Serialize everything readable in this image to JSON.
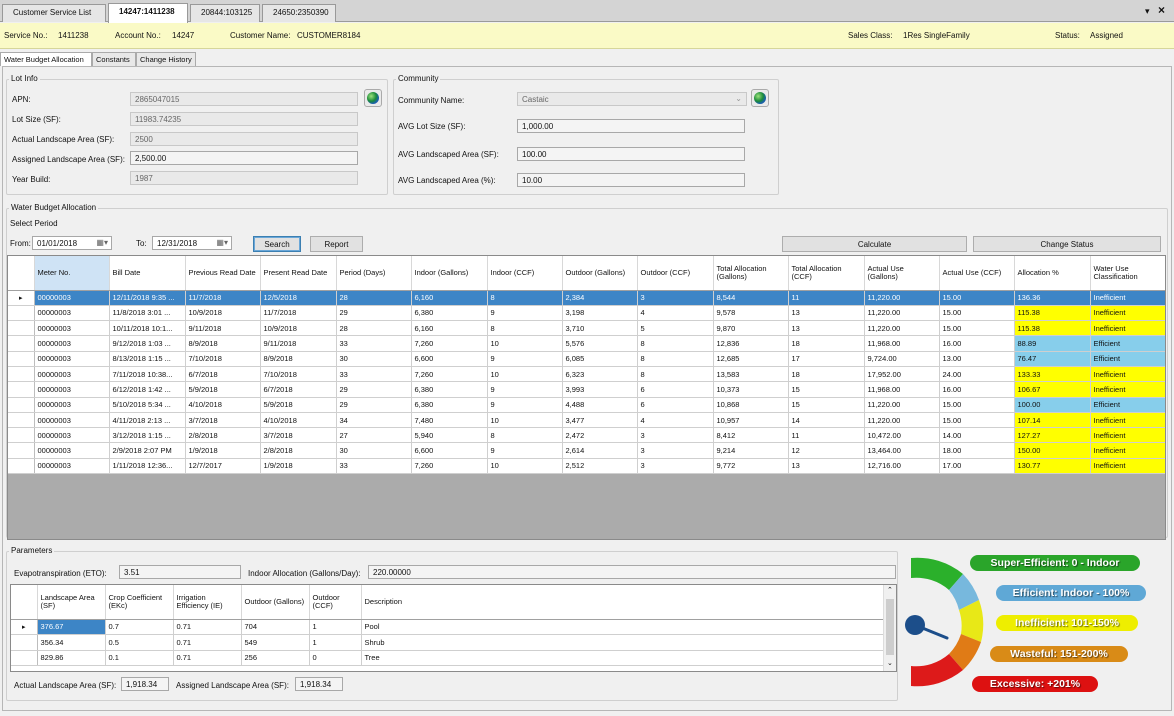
{
  "tabs": [
    {
      "label": "Customer Service List",
      "active": false
    },
    {
      "label": "14247:1411238",
      "active": true
    },
    {
      "label": "20844:103125",
      "active": false
    },
    {
      "label": "24650:2350390",
      "active": false
    }
  ],
  "window_controls": {
    "dropdown": "▾",
    "close": "×"
  },
  "info": {
    "service_no_label": "Service No.:",
    "service_no": "1411238",
    "account_no_label": "Account No.:",
    "account_no": "14247",
    "customer_name_label": "Customer Name:",
    "customer_name": "CUSTOMER8184",
    "sales_class_label": "Sales Class:",
    "sales_class": "1Res SingleFamily",
    "status_label": "Status:",
    "status": "Assigned"
  },
  "subtabs": [
    "Water Budget Allocation",
    "Constants",
    "Change History"
  ],
  "lot_info": {
    "legend": "Lot Info",
    "apn_label": "APN:",
    "apn": "2865047015",
    "lot_size_label": "Lot Size (SF):",
    "lot_size": "11983.74235",
    "actual_landscape_label": "Actual Landscape Area (SF):",
    "actual_landscape": "2500",
    "assigned_landscape_label": "Assigned Landscape Area (SF):",
    "assigned_landscape": "2,500.00",
    "year_build_label": "Year Build:",
    "year_build": "1987"
  },
  "community": {
    "legend": "Community",
    "name_label": "Community Name:",
    "name": "Castaic",
    "avg_lot_label": "AVG Lot Size (SF):",
    "avg_lot": "1,000.00",
    "avg_landscaped_label": "AVG Landscaped Area (SF):",
    "avg_landscaped": "100.00",
    "avg_landscaped_pct_label": "AVG Landscaped Area (%):",
    "avg_landscaped_pct": "10.00"
  },
  "wba": {
    "legend": "Water Budget Allocation",
    "select_period": "Select Period",
    "from_label": "From:",
    "from": "01/01/2018",
    "to_label": "To:",
    "to": "12/31/2018",
    "search": "Search",
    "report": "Report",
    "calculate": "Calculate",
    "change_status": "Change Status"
  },
  "bill_table": {
    "columns": [
      "Meter No.",
      "Bill Date",
      "Previous Read Date",
      "Present Read Date",
      "Period (Days)",
      "Indoor (Gallons)",
      "Indoor (CCF)",
      "Outdoor (Gallons)",
      "Outdoor (CCF)",
      "Total Allocation (Gallons)",
      "Total Allocation (CCF)",
      "Actual Use (Gallons)",
      "Actual Use (CCF)",
      "Allocation %",
      "Water Use Classification"
    ],
    "rows": [
      [
        "00000003",
        "12/11/2018 9:35 ...",
        "11/7/2018",
        "12/5/2018",
        "28",
        "6,160",
        "8",
        "2,384",
        "3",
        "8,544",
        "11",
        "11,220.00",
        "15.00",
        "136.36",
        "Inefficient"
      ],
      [
        "00000003",
        "11/8/2018 3:01 ...",
        "10/9/2018",
        "11/7/2018",
        "29",
        "6,380",
        "9",
        "3,198",
        "4",
        "9,578",
        "13",
        "11,220.00",
        "15.00",
        "115.38",
        "Inefficient"
      ],
      [
        "00000003",
        "10/11/2018 10:1...",
        "9/11/2018",
        "10/9/2018",
        "28",
        "6,160",
        "8",
        "3,710",
        "5",
        "9,870",
        "13",
        "11,220.00",
        "15.00",
        "115.38",
        "Inefficient"
      ],
      [
        "00000003",
        "9/12/2018 1:03 ...",
        "8/9/2018",
        "9/11/2018",
        "33",
        "7,260",
        "10",
        "5,576",
        "8",
        "12,836",
        "18",
        "11,968.00",
        "16.00",
        "88.89",
        "Efficient"
      ],
      [
        "00000003",
        "8/13/2018 1:15 ...",
        "7/10/2018",
        "8/9/2018",
        "30",
        "6,600",
        "9",
        "6,085",
        "8",
        "12,685",
        "17",
        "9,724.00",
        "13.00",
        "76.47",
        "Efficient"
      ],
      [
        "00000003",
        "7/11/2018 10:38...",
        "6/7/2018",
        "7/10/2018",
        "33",
        "7,260",
        "10",
        "6,323",
        "8",
        "13,583",
        "18",
        "17,952.00",
        "24.00",
        "133.33",
        "Inefficient"
      ],
      [
        "00000003",
        "6/12/2018 1:42 ...",
        "5/9/2018",
        "6/7/2018",
        "29",
        "6,380",
        "9",
        "3,993",
        "6",
        "10,373",
        "15",
        "11,968.00",
        "16.00",
        "106.67",
        "Inefficient"
      ],
      [
        "00000003",
        "5/10/2018 5:34 ...",
        "4/10/2018",
        "5/9/2018",
        "29",
        "6,380",
        "9",
        "4,488",
        "6",
        "10,868",
        "15",
        "11,220.00",
        "15.00",
        "100.00",
        "Efficient"
      ],
      [
        "00000003",
        "4/11/2018 2:13 ...",
        "3/7/2018",
        "4/10/2018",
        "34",
        "7,480",
        "10",
        "3,477",
        "4",
        "10,957",
        "14",
        "11,220.00",
        "15.00",
        "107.14",
        "Inefficient"
      ],
      [
        "00000003",
        "3/12/2018 1:15 ...",
        "2/8/2018",
        "3/7/2018",
        "27",
        "5,940",
        "8",
        "2,472",
        "3",
        "8,412",
        "11",
        "10,472.00",
        "14.00",
        "127.27",
        "Inefficient"
      ],
      [
        "00000003",
        "2/9/2018 2:07 PM",
        "1/9/2018",
        "2/8/2018",
        "30",
        "6,600",
        "9",
        "2,614",
        "3",
        "9,214",
        "12",
        "13,464.00",
        "18.00",
        "150.00",
        "Inefficient"
      ],
      [
        "00000003",
        "1/11/2018 12:36...",
        "12/7/2017",
        "1/9/2018",
        "33",
        "7,260",
        "10",
        "2,512",
        "3",
        "9,772",
        "13",
        "12,716.00",
        "17.00",
        "130.77",
        "Inefficient"
      ]
    ],
    "allocation_colors": [
      "sel",
      "#ffff00",
      "#ffff00",
      "#87ceeb",
      "#87ceeb",
      "#ffff00",
      "#ffff00",
      "#87ceeb",
      "#ffff00",
      "#ffff00",
      "#ffff00",
      "#ffff00"
    ]
  },
  "parameters": {
    "legend": "Parameters",
    "eto_label": "Evapotranspiration (ETO):",
    "eto": "3.51",
    "indoor_label": "Indoor Allocation (Gallons/Day):",
    "indoor": "220.00000",
    "columns": [
      "Landscape Area (SF)",
      "Crop Coefficient (EKc)",
      "Irrigation Efficiency (IE)",
      "Outdoor (Gallons)",
      "Outdoor (CCF)",
      "Description"
    ],
    "rows": [
      [
        "376.67",
        "0.7",
        "0.71",
        "704",
        "1",
        "Pool"
      ],
      [
        "356.34",
        "0.5",
        "0.71",
        "549",
        "1",
        "Shrub"
      ],
      [
        "829.86",
        "0.1",
        "0.71",
        "256",
        "0",
        "Tree"
      ]
    ],
    "actual_total_label": "Actual Landscape Area (SF):",
    "actual_total": "1,918.34",
    "assigned_total_label": "Assigned Landscape Area (SF):",
    "assigned_total": "1,918.34"
  },
  "gauge_legend": [
    {
      "label": "Super-Efficient:  0 - Indoor",
      "color": "#22aa22"
    },
    {
      "label": "Efficient:  Indoor - 100%",
      "color": "#5fa8d6"
    },
    {
      "label": "Inefficient:  101-150%",
      "color": "#eeee00"
    },
    {
      "label": "Wasteful:  151-200%",
      "color": "#d98b17"
    },
    {
      "label": "Excessive:  +201%",
      "color": "#dd1111"
    }
  ],
  "colors": {
    "selected_row": "#3d85c6",
    "info_bar": "#fafac6",
    "inefficient": "#ffff00",
    "efficient": "#87ceeb"
  }
}
